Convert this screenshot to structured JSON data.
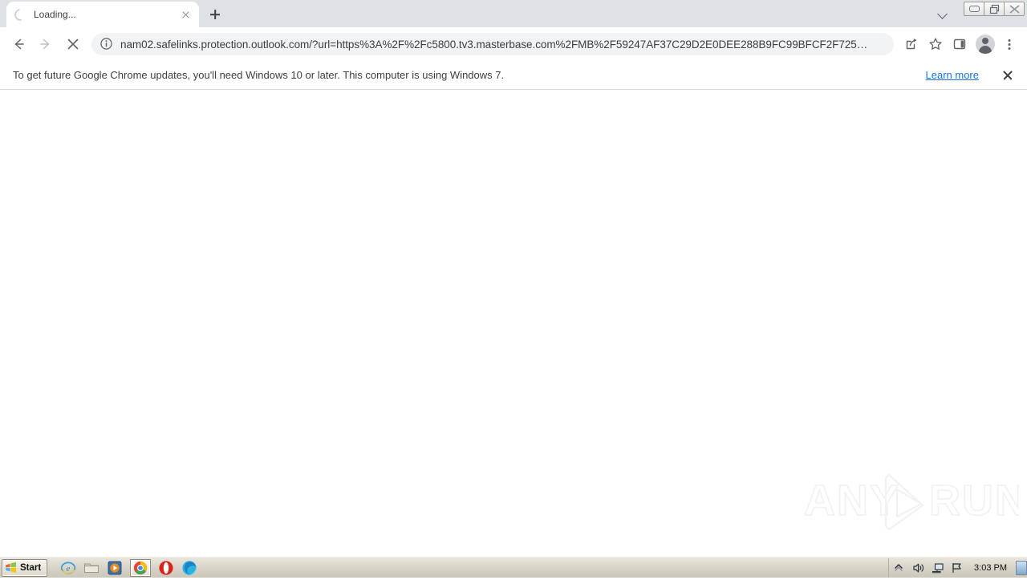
{
  "window": {
    "controls": [
      {
        "name": "minimize-button",
        "label": "Minimize"
      },
      {
        "name": "restore-button",
        "label": "Restore"
      },
      {
        "name": "close-button",
        "label": "Close"
      }
    ]
  },
  "tabstrip": {
    "active_tab": {
      "title": "Loading...",
      "favicon": "loading-spinner",
      "close_label": "Close tab"
    },
    "new_tab_label": "New Tab",
    "tab_search_label": "Search tabs"
  },
  "toolbar": {
    "back_label": "Back",
    "forward_label": "Forward",
    "stop_label": "Stop loading this page",
    "site_info_label": "View site information",
    "url": "nam02.safelinks.protection.outlook.com/?url=https%3A%2F%2Fc5800.tv3.masterbase.com%2FMB%2F59247AF37C29D2E0DEE288B9FC99BFCF2F725…",
    "share_label": "Share this page",
    "bookmark_label": "Bookmark this tab",
    "side_panel_label": "Show side panel",
    "profile_label": "Profile",
    "menu_label": "Customize and control Google Chrome"
  },
  "infobar": {
    "message": "To get future Google Chrome updates, you'll need Windows 10 or later. This computer is using Windows 7.",
    "link": "Learn more",
    "close_label": "Close",
    "link_color": "#1a73e8"
  },
  "page": {
    "content": "",
    "background": "#ffffff"
  },
  "watermark": {
    "text_left": "ANY",
    "text_right": "RUN",
    "logo": "play-triangle-logo"
  },
  "taskbar": {
    "start_label": "Start",
    "quick_launch": [
      {
        "name": "taskbar-internet-explorer",
        "label": "Internet Explorer"
      },
      {
        "name": "taskbar-windows-explorer",
        "label": "Windows Explorer"
      },
      {
        "name": "taskbar-media-player",
        "label": "Windows Media Player"
      },
      {
        "name": "taskbar-google-chrome",
        "label": "Google Chrome",
        "active": true
      },
      {
        "name": "taskbar-opera",
        "label": "Opera"
      },
      {
        "name": "taskbar-microsoft-edge",
        "label": "Microsoft Edge"
      }
    ],
    "tray": [
      {
        "name": "show-hidden-icons-button",
        "label": "Show hidden icons"
      },
      {
        "name": "volume-icon",
        "label": "Volume"
      },
      {
        "name": "network-icon",
        "label": "Network"
      },
      {
        "name": "action-center-icon",
        "label": "Action Center"
      }
    ],
    "clock": "3:03 PM",
    "show_desktop_label": "Show desktop"
  }
}
